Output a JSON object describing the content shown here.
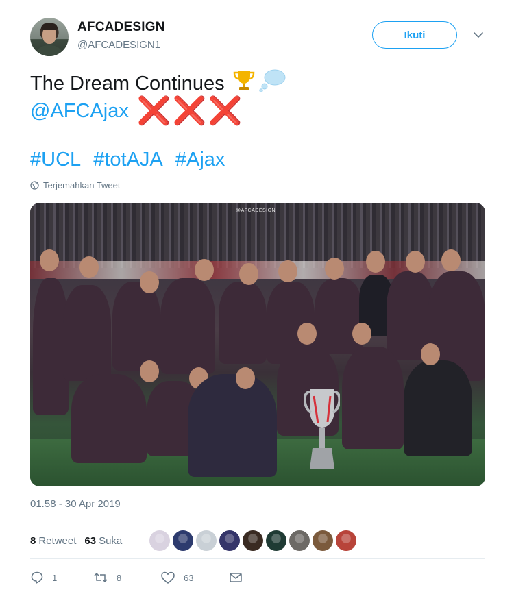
{
  "author": {
    "name": "AFCADESIGN",
    "handle": "@AFCADESIGN1"
  },
  "follow_button": {
    "label": "Ikuti"
  },
  "tweet": {
    "text_line1": "The Dream Continues",
    "mention": "@AFCAjax",
    "crosses": "❌❌❌",
    "hashtags": [
      "#UCL",
      "#totAJA",
      "#Ajax"
    ],
    "translate_label": "Terjemahkan Tweet",
    "timestamp": "01.58 - 30 Apr 2019",
    "photo_watermark": "@AFCADESIGN"
  },
  "stats": {
    "retweets_count": "8",
    "retweets_label": "Retweet",
    "likes_count": "63",
    "likes_label": "Suka"
  },
  "likers": [
    {
      "color": "#d9d2e0"
    },
    {
      "color": "#2d3b6e"
    },
    {
      "color": "#c9d0d6"
    },
    {
      "color": "#35356a"
    },
    {
      "color": "#3a2b22"
    },
    {
      "color": "#1f3b34"
    },
    {
      "color": "#6d6a66"
    },
    {
      "color": "#7b5a3c"
    },
    {
      "color": "#b8443a"
    }
  ],
  "actions": {
    "reply_count": "1",
    "retweet_count": "8",
    "like_count": "63"
  },
  "colors": {
    "accent": "#1da1f2",
    "secondary_text": "#657786",
    "cross_red": "#e0242e"
  }
}
